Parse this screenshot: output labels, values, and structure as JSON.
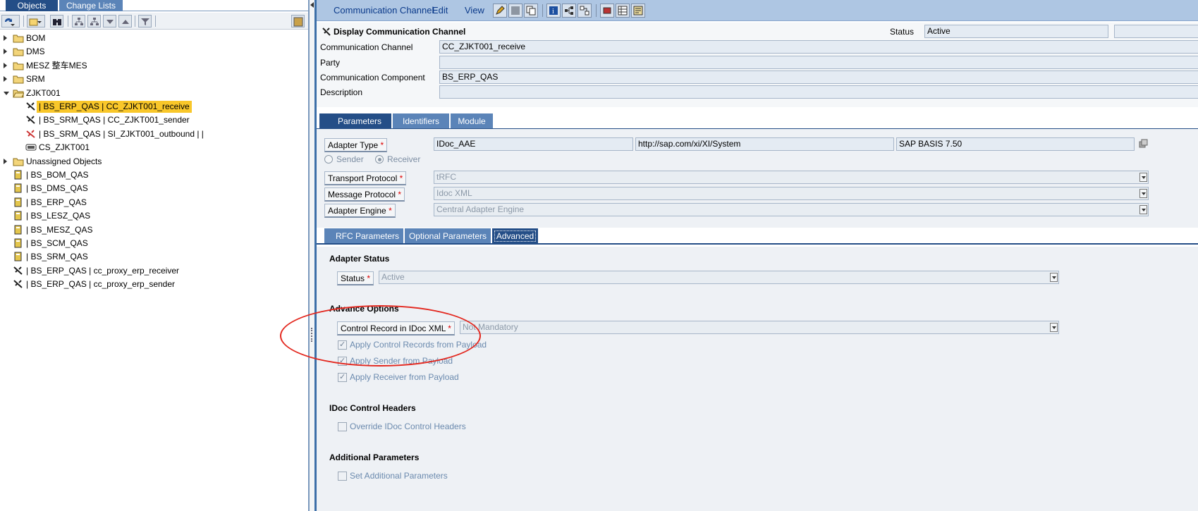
{
  "left": {
    "tabs": {
      "objects": "Objects",
      "change_lists": "Change Lists"
    },
    "tree": [
      {
        "label": "BOM",
        "icon": "folder-icon",
        "level": 0,
        "arrow": "right"
      },
      {
        "label": "DMS",
        "icon": "folder-icon",
        "level": 0,
        "arrow": "right"
      },
      {
        "label": "MESZ  整车MES",
        "icon": "folder-icon",
        "level": 0,
        "arrow": "right"
      },
      {
        "label": "SRM",
        "icon": "folder-icon",
        "level": 0,
        "arrow": "right"
      },
      {
        "label": "ZJKT001",
        "icon": "folder-open-icon",
        "level": 0,
        "arrow": "down"
      },
      {
        "label": "| BS_ERP_QAS | CC_ZJKT001_receive",
        "icon": "channel-icon",
        "level": 2,
        "selected": true
      },
      {
        "label": "| BS_SRM_QAS | CC_ZJKT001_sender",
        "icon": "channel-icon",
        "level": 2
      },
      {
        "label": "| BS_SRM_QAS | SI_ZJKT001_outbound |  |",
        "icon": "agreement-icon",
        "level": 2
      },
      {
        "label": "CS_ZJKT001",
        "icon": "scenario-icon",
        "level": 2
      },
      {
        "label": "Unassigned Objects",
        "icon": "folder-icon",
        "level": 0,
        "arrow": "right"
      },
      {
        "label": "| BS_BOM_QAS",
        "icon": "component-icon",
        "level": 1
      },
      {
        "label": "| BS_DMS_QAS",
        "icon": "component-icon",
        "level": 1
      },
      {
        "label": "| BS_ERP_QAS",
        "icon": "component-icon",
        "level": 1
      },
      {
        "label": "| BS_LESZ_QAS",
        "icon": "component-icon",
        "level": 1
      },
      {
        "label": "| BS_MESZ_QAS",
        "icon": "component-icon",
        "level": 1
      },
      {
        "label": "| BS_SCM_QAS",
        "icon": "component-icon",
        "level": 1
      },
      {
        "label": "| BS_SRM_QAS",
        "icon": "component-icon",
        "level": 1
      },
      {
        "label": "| BS_ERP_QAS | cc_proxy_erp_receiver",
        "icon": "channel-icon",
        "level": 1
      },
      {
        "label": "| BS_ERP_QAS | cc_proxy_erp_sender",
        "icon": "channel-icon",
        "level": 1
      }
    ]
  },
  "menu": {
    "channel": "Communication Channel",
    "edit": "Edit",
    "view": "View"
  },
  "header": {
    "title": "Display Communication Channel",
    "status_label": "Status",
    "status_value": "Active",
    "channel_label": "Communication Channel",
    "channel_value": "CC_ZJKT001_receive",
    "party_label": "Party",
    "party_value": "",
    "component_label": "Communication Component",
    "component_value": "BS_ERP_QAS",
    "description_label": "Description",
    "description_value": ""
  },
  "main_tabs": {
    "parameters": "Parameters",
    "identifiers": "Identifiers",
    "module": "Module"
  },
  "parameters": {
    "adapter_type_label": "Adapter Type",
    "adapter_type": "IDoc_AAE",
    "adapter_namespace": "http://sap.com/xi/XI/System",
    "adapter_swcv": "SAP BASIS 7.50",
    "sender_label": "Sender",
    "receiver_label": "Receiver",
    "transport_label": "Transport Protocol",
    "transport_value": "tRFC",
    "message_label": "Message Protocol",
    "message_value": "Idoc XML",
    "engine_label": "Adapter Engine",
    "engine_value": "Central Adapter Engine"
  },
  "sub_tabs": {
    "rfc": "RFC Parameters",
    "optional": "Optional Parameters",
    "advanced": "Advanced"
  },
  "advanced": {
    "adapter_status_title": "Adapter Status",
    "status_label": "Status",
    "status_value": "Active",
    "advance_options_title": "Advance Options",
    "control_record_label": "Control Record in IDoc XML",
    "control_record_value": "Not Mandatory",
    "apply_control": "Apply Control Records from Payload",
    "apply_sender": "Apply Sender from Payload",
    "apply_receiver": "Apply Receiver from Payload",
    "idoc_headers_title": "IDoc Control Headers",
    "override_headers": "Override IDoc Control Headers",
    "additional_title": "Additional Parameters",
    "set_additional": "Set Additional Parameters"
  }
}
